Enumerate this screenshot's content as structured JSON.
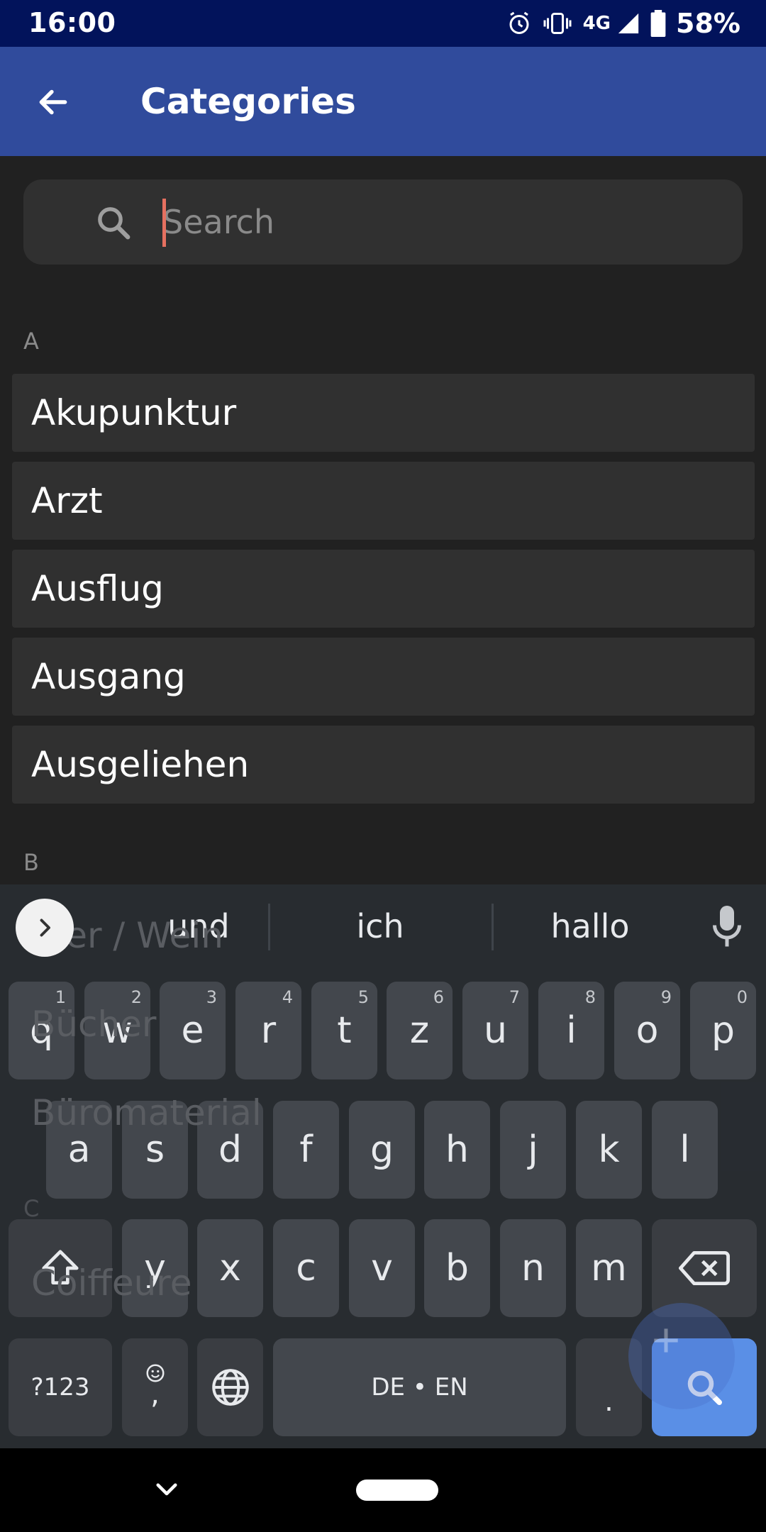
{
  "status_bar": {
    "time": "16:00",
    "network": "4G",
    "battery_percent": "58%"
  },
  "app_bar": {
    "title": "Categories"
  },
  "search": {
    "placeholder": "Search",
    "value": ""
  },
  "sections": [
    {
      "letter": "A",
      "items": [
        "Akupunktur",
        "Arzt",
        "Ausflug",
        "Ausgang",
        "Ausgeliehen"
      ]
    },
    {
      "letter": "B",
      "items": [
        "Bier / Wein",
        "Bücher",
        "Büromaterial"
      ]
    },
    {
      "letter": "C",
      "items": [
        "Coiffeure"
      ]
    }
  ],
  "keyboard": {
    "suggestions": [
      "und",
      "ich",
      "hallo"
    ],
    "row1": [
      {
        "key": "q",
        "hint": "1"
      },
      {
        "key": "w",
        "hint": "2"
      },
      {
        "key": "e",
        "hint": "3"
      },
      {
        "key": "r",
        "hint": "4"
      },
      {
        "key": "t",
        "hint": "5"
      },
      {
        "key": "z",
        "hint": "6"
      },
      {
        "key": "u",
        "hint": "7"
      },
      {
        "key": "i",
        "hint": "8"
      },
      {
        "key": "o",
        "hint": "9"
      },
      {
        "key": "p",
        "hint": "0"
      }
    ],
    "row2": [
      "a",
      "s",
      "d",
      "f",
      "g",
      "h",
      "j",
      "k",
      "l"
    ],
    "row3": [
      "y",
      "x",
      "c",
      "v",
      "b",
      "n",
      "m"
    ],
    "symbols_label": "?123",
    "comma_label": ",",
    "space_label": "DE • EN",
    "period_label": "."
  },
  "icons": {
    "back": "arrow-left-icon",
    "search": "search-icon",
    "mic": "mic-icon",
    "shift": "shift-icon",
    "backspace": "backspace-icon",
    "globe": "globe-icon",
    "emoji": "emoji-icon",
    "expand": "chevron-right-icon",
    "add": "plus-icon"
  },
  "colors": {
    "status_bar": "#02135b",
    "app_bar": "#304b9c",
    "background": "#212121",
    "list_item": "#303030",
    "keyboard_action": "#5a8fe6"
  }
}
